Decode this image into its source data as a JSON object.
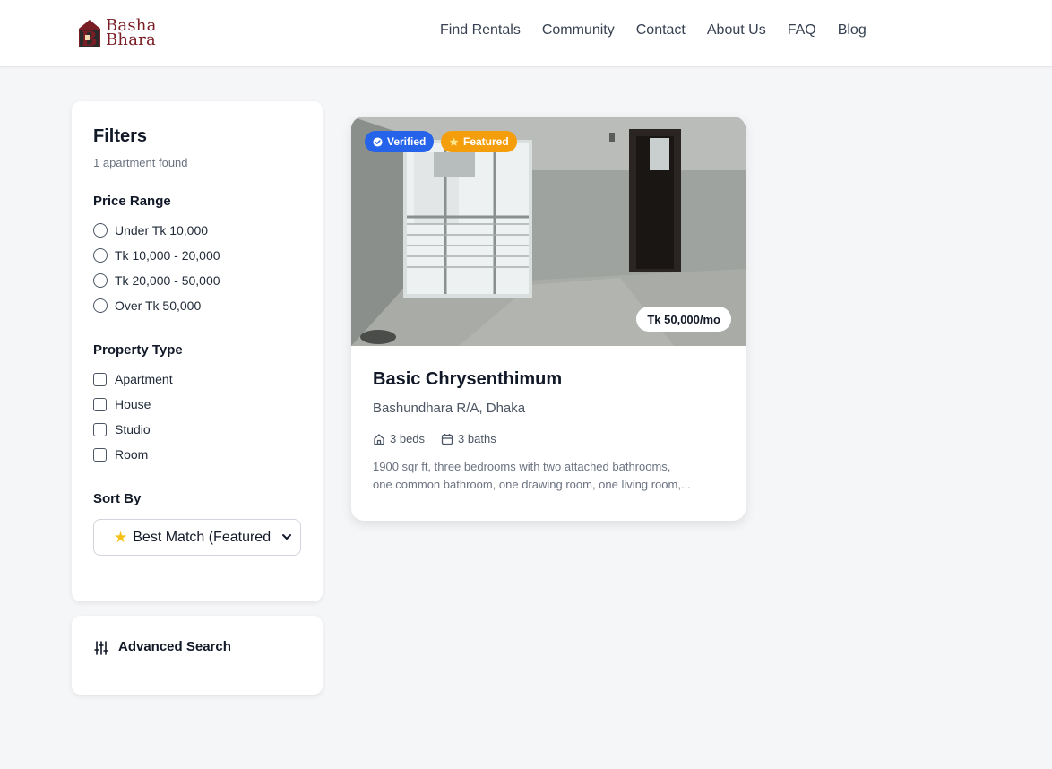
{
  "brand": {
    "line1": "Basha",
    "line2": "Bhara"
  },
  "nav": {
    "items": [
      "Find Rentals",
      "Community",
      "Contact",
      "About Us",
      "FAQ",
      "Blog"
    ]
  },
  "filters": {
    "title": "Filters",
    "count": "1 apartment found",
    "price_range": {
      "title": "Price Range",
      "options": [
        "Under Tk 10,000",
        "Tk 10,000 - 20,000",
        "Tk 20,000 - 50,000",
        "Over Tk 50,000"
      ]
    },
    "property_type": {
      "title": "Property Type",
      "options": [
        "Apartment",
        "House",
        "Studio",
        "Room"
      ]
    },
    "sort": {
      "title": "Sort By",
      "selected": "Best Match (Featured"
    }
  },
  "advanced_search": {
    "label": "Advanced Search"
  },
  "listing": {
    "badges": {
      "verified": "Verified",
      "featured": "Featured"
    },
    "price": "Tk 50,000/mo",
    "title": "Basic Chrysenthimum",
    "location": "Bashundhara R/A, Dhaka",
    "beds": "3 beds",
    "baths": "3 baths",
    "description_line1": "1900 sqr ft, three bedrooms with two attached bathrooms,",
    "description_line2": "one common bathroom, one drawing room, one living room,..."
  },
  "colors": {
    "brand": "#7a1e25",
    "verified": "#2563eb",
    "featured": "#f59e0b",
    "background": "#f5f6f8"
  },
  "icons": {
    "verified": "check-circle-icon",
    "featured": "star-icon",
    "beds": "home-icon",
    "baths": "calendar-icon",
    "advanced": "sliders-icon",
    "sort": "star-icon",
    "select": "chevron-down-icon"
  }
}
